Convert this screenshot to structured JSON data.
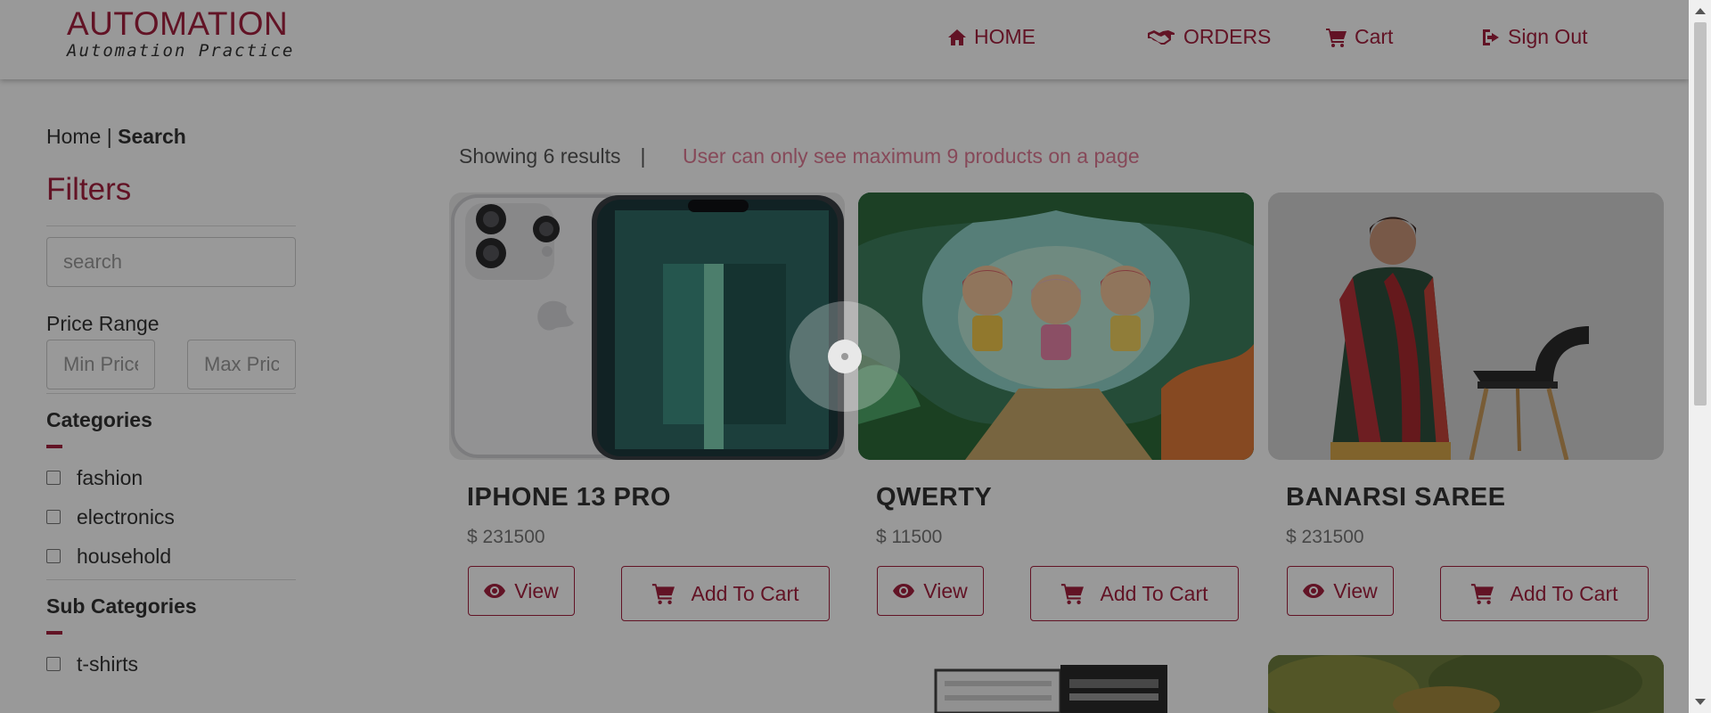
{
  "header": {
    "logo_title": "AUTOMATION",
    "logo_subtitle": "Automation Practice",
    "nav": {
      "home": "HOME",
      "orders": "ORDERS",
      "cart": "Cart",
      "signout": "Sign Out"
    }
  },
  "sidebar": {
    "breadcrumb_home": "Home",
    "breadcrumb_sep": " | ",
    "breadcrumb_current": "Search",
    "filters_title": "Filters",
    "search_placeholder": "search",
    "price_range_label": "Price Range",
    "min_price_placeholder": "Min Price",
    "max_price_placeholder": "Max Price",
    "categories_title": "Categories",
    "categories": [
      "fashion",
      "electronics",
      "household"
    ],
    "subcategories_title": "Sub Categories",
    "subcategories": [
      "t-shirts"
    ]
  },
  "results": {
    "count_text": "Showing 6 results",
    "separator": "|",
    "note": "User can only see maximum 9 products on a page"
  },
  "products": [
    {
      "name": "IPHONE 13 PRO",
      "price": "$ 231500",
      "view_label": "View",
      "cart_label": "Add To Cart"
    },
    {
      "name": "QWERTY",
      "price": "$ 11500",
      "view_label": "View",
      "cart_label": "Add To Cart"
    },
    {
      "name": "BANARSI SAREE",
      "price": "$ 231500",
      "view_label": "View",
      "cart_label": "Add To Cart"
    }
  ],
  "colors": {
    "accent": "#a3213f",
    "note": "#e07a94",
    "overlay": "rgba(0,0,0,0.40)"
  },
  "icons": [
    "home-icon",
    "handshake-icon",
    "cart-icon",
    "sign-out-icon",
    "eye-icon",
    "loading-spinner-icon"
  ]
}
